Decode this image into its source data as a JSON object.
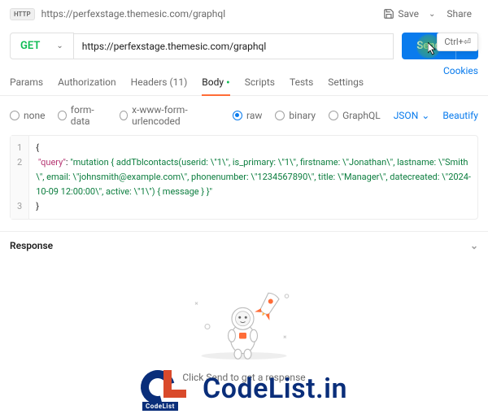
{
  "topbar": {
    "http_badge": "HTTP",
    "url": "https://perfexstage.themesic.com/graphql",
    "save_label": "Save",
    "share_label": "Share"
  },
  "request": {
    "method": "GET",
    "url_value": "https://perfexstage.themesic.com/graphql",
    "send_label": "Send",
    "send_hint": "Ctrl+⏎",
    "cookies_label": "Cookies"
  },
  "tabs": {
    "params": "Params",
    "auth": "Authorization",
    "headers": "Headers (11)",
    "body": "Body",
    "scripts": "Scripts",
    "tests": "Tests",
    "settings": "Settings"
  },
  "body_opts": {
    "none": "none",
    "form_data": "form-data",
    "urlencoded": "x-www-form-urlencoded",
    "raw": "raw",
    "binary": "binary",
    "graphql": "GraphQL",
    "selected": "raw",
    "format": "JSON",
    "beautify": "Beautify"
  },
  "editor": {
    "line1": "{",
    "key": "\"query\"",
    "val": "\"mutation { addTblcontacts(userid: \\\"1\\\", is_primary: \\\"1\\\", firstname: \\\"Jonathan\\\", lastname: \\\"Smith\\\", email: \\\"johnsmith@example.com\\\", phonenumber: \\\"1234567890\\\", title: \\\"Manager\\\", datecreated: \\\"2024-10-09 12:00:00\\\", active: \\\"1\\\") { message } }\"",
    "line3": "}"
  },
  "response": {
    "title": "Response",
    "hint": "Click Send to get a response"
  },
  "watermark": {
    "sub": "CodeList",
    "text": "CodeList.in"
  }
}
